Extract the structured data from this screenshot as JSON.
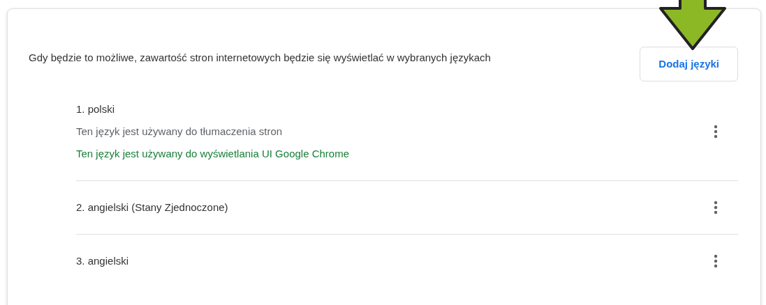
{
  "description": "Gdy będzie to możliwe, zawartość stron internetowych będzie się wyświetlać w wybranych językach",
  "add_button": "Dodaj języki",
  "languages": [
    {
      "label": "1. polski",
      "notes": [
        {
          "kind": "info",
          "text": "Ten język jest używany do tłumaczenia stron"
        },
        {
          "kind": "ui",
          "text": "Ten język jest używany do wyświetlania UI Google Chrome"
        }
      ]
    },
    {
      "label": "2. angielski (Stany Zjednoczone)"
    },
    {
      "label": "3. angielski"
    }
  ]
}
